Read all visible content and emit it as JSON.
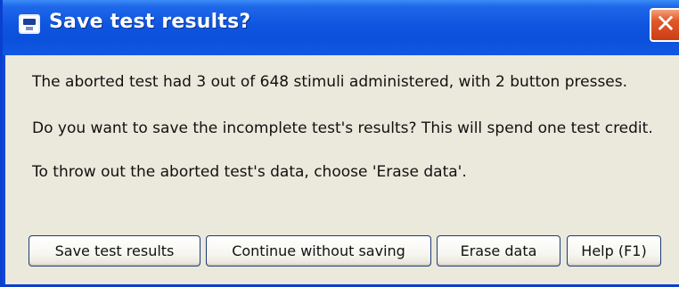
{
  "dialog": {
    "title": "Save test results?",
    "close_glyph": "✕",
    "icon": "app-window-icon",
    "messages": {
      "line1": "The aborted test had 3 out of 648 stimuli administered, with 2 button presses.",
      "line2": "Do you want to save the incomplete test's results? This will spend one test credit.",
      "line3": "To throw out the aborted test's data, choose 'Erase data'."
    },
    "buttons": {
      "save": "Save test results",
      "continue": "Continue without saving",
      "erase": "Erase data",
      "help": "Help (F1)"
    }
  },
  "colors": {
    "titlebar": "#0b50da",
    "client_background": "#ebe9dc",
    "close_button": "#e1592b"
  }
}
